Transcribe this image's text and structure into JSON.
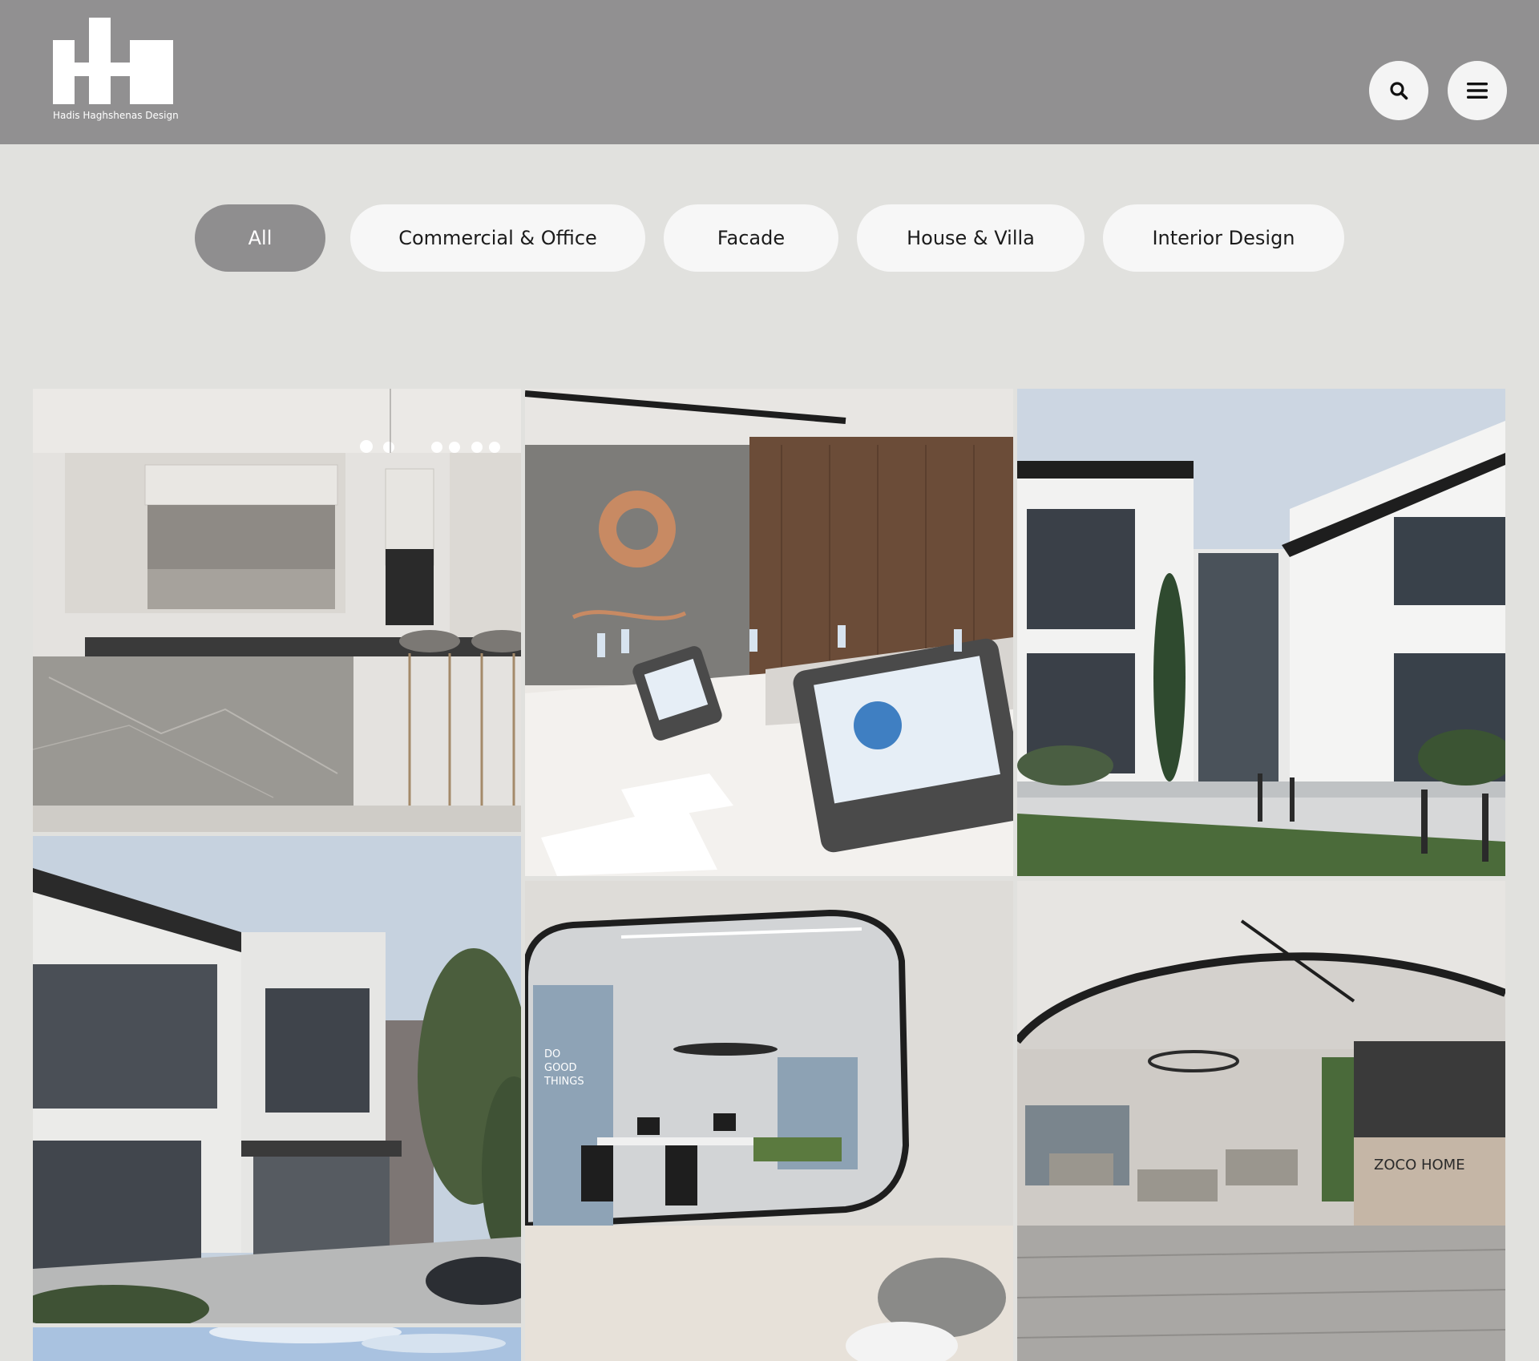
{
  "header": {
    "logo_caption": "Hadis Haghshenas Design",
    "search_icon": "search-icon",
    "menu_icon": "hamburger-menu-icon"
  },
  "filters": [
    {
      "label": "All",
      "active": true
    },
    {
      "label": "Commercial & Office",
      "active": false
    },
    {
      "label": "Facade",
      "active": false
    },
    {
      "label": "House & Villa",
      "active": false
    },
    {
      "label": "Interior Design",
      "active": false
    }
  ],
  "gallery": {
    "items": [
      {
        "subject": "kitchen-interior"
      },
      {
        "subject": "conference-room"
      },
      {
        "subject": "villa-facade"
      },
      {
        "subject": "house-facade"
      },
      {
        "subject": "glass-office"
      },
      {
        "subject": "showroom-lobby",
        "sign_text": "ZOCO HOME",
        "wall_text": [
          "DO",
          "GOOD",
          "THINGS"
        ]
      },
      {
        "subject": "sky-partial"
      }
    ]
  },
  "office_wall_text": [
    "DO",
    "GOOD",
    "THINGS"
  ],
  "reception_sign": "ZOCO HOME",
  "colors": {
    "header_bg": "#919091",
    "page_bg": "#e1e1de",
    "pill_bg": "#f7f7f7",
    "pill_active_bg": "#8f8e8f"
  }
}
